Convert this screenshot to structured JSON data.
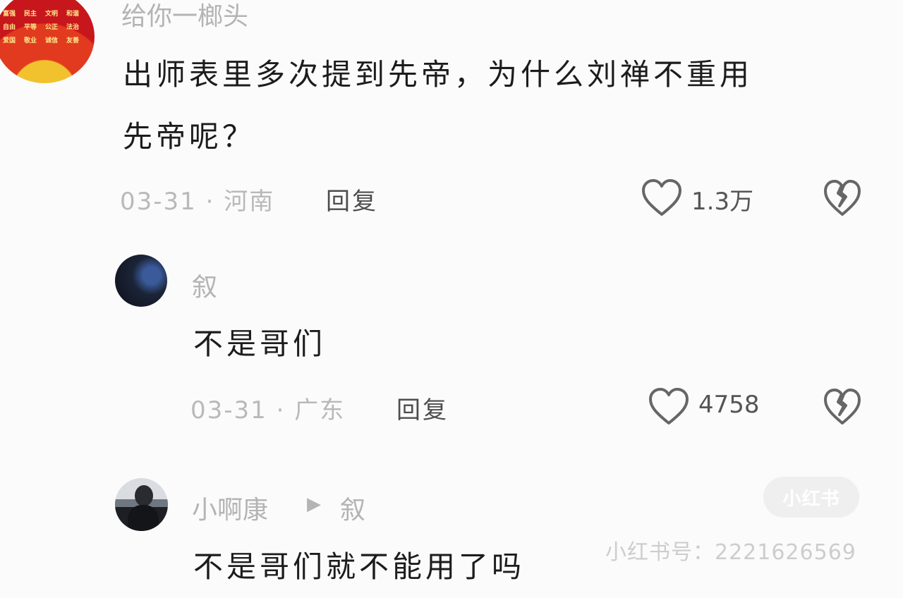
{
  "comments": [
    {
      "username": "给你一榔头",
      "avatar_text": [
        "富强",
        "民主",
        "文明",
        "和谐",
        "自由",
        "平等",
        "公正",
        "法治",
        "爱国",
        "敬业",
        "诚信",
        "友善"
      ],
      "text_line1": "出师表里多次提到先帝，为什么刘禅不重用",
      "text_line2": "先帝呢？",
      "meta": "03-31 · 河南",
      "reply_label": "回复",
      "like_count": "1.3万"
    },
    {
      "username": "叙",
      "text": "不是哥们",
      "meta": "03-31 · 广东",
      "reply_label": "回复",
      "like_count": "4758"
    },
    {
      "username": "小啊康",
      "reply_to_arrow": "▶",
      "reply_to": "叙",
      "text": "不是哥们就不能用了吗"
    }
  ],
  "watermark": {
    "badge": "小红书",
    "id_text": "小红书号：2221626569"
  },
  "colors": {
    "background": "#fbfbfb",
    "username": "#b4b4b4",
    "text": "#1c1c1c",
    "icon_stroke": "#666666"
  },
  "icons": {
    "like": "heart-outline-icon",
    "dislike": "broken-heart-icon",
    "reply_arrow": "play-arrow-icon"
  }
}
